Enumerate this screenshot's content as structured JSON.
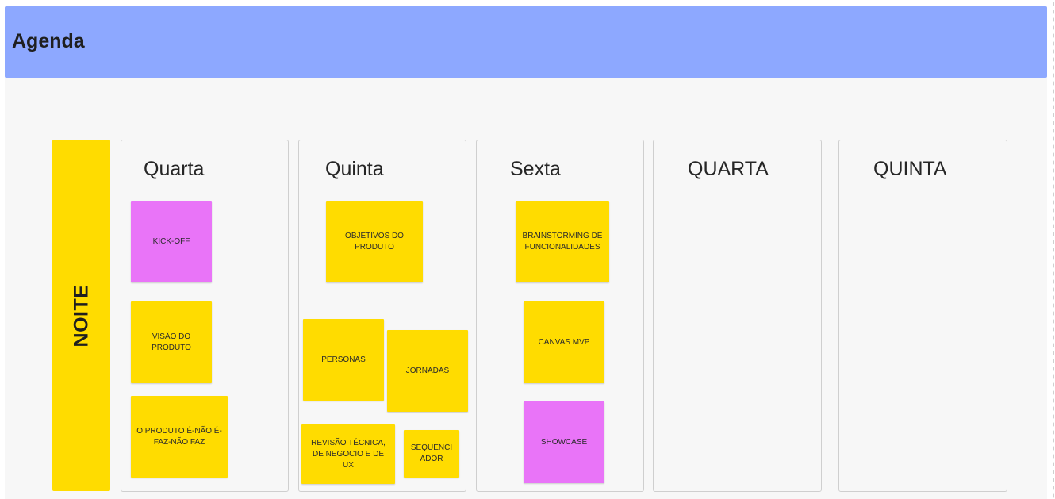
{
  "board": {
    "title": "Agenda",
    "side_label": "NOITE",
    "colors": {
      "header": "#8da8ff",
      "side_label": "#ffdc00",
      "sticky_yellow": "#ffdc00",
      "sticky_pink": "#e974f8",
      "canvas": "#f7f7f7"
    }
  },
  "columns": [
    {
      "title": "Quarta",
      "notes": [
        {
          "text": "KICK-OFF",
          "color": "pink"
        },
        {
          "text": "VISÃO DO PRODUTO",
          "color": "yellow"
        },
        {
          "text": "O PRODUTO É-NÃO É- FAZ-NÃO FAZ",
          "color": "yellow"
        }
      ]
    },
    {
      "title": "Quinta",
      "notes": [
        {
          "text": "OBJETIVOS DO PRODUTO",
          "color": "yellow"
        },
        {
          "text": "PERSONAS",
          "color": "yellow"
        },
        {
          "text": "JORNADAS",
          "color": "yellow"
        },
        {
          "text": "REVISÃO TÉCNICA, DE NEGOCIO E DE UX",
          "color": "yellow"
        },
        {
          "text": "SEQUENCI ADOR",
          "color": "yellow"
        }
      ]
    },
    {
      "title": "Sexta",
      "notes": [
        {
          "text": "BRAINSTORMING DE FUNCIONALIDADES",
          "color": "yellow"
        },
        {
          "text": "CANVAS MVP",
          "color": "yellow"
        },
        {
          "text": "SHOWCASE",
          "color": "pink"
        }
      ]
    },
    {
      "title": "QUARTA",
      "notes": []
    },
    {
      "title": "QUINTA",
      "notes": []
    }
  ]
}
